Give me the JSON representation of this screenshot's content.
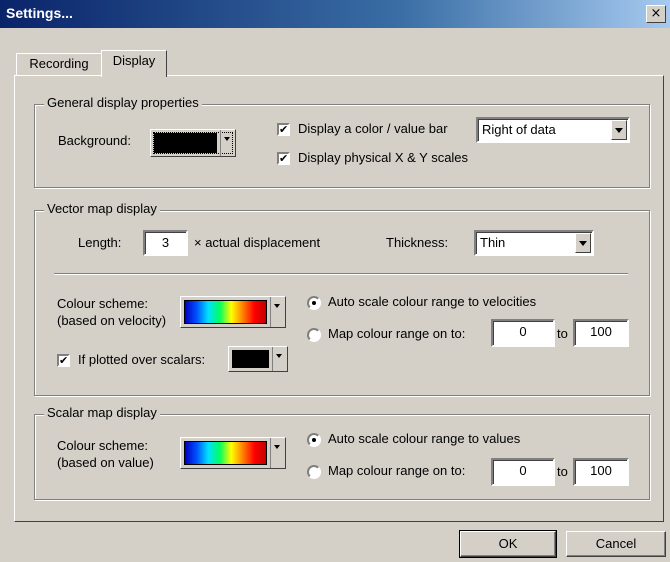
{
  "window": {
    "title": "Settings...",
    "close_label": "×"
  },
  "tabs": [
    {
      "label": "Recording"
    },
    {
      "label": "Display"
    }
  ],
  "general": {
    "group_title": "General display properties",
    "background_label": "Background:",
    "background_color": "#000000",
    "color_bar_label": "Display a color / value bar",
    "color_bar_checked": true,
    "color_bar_position": "Right of data",
    "physical_scales_label": "Display physical X & Y scales",
    "physical_scales_checked": true
  },
  "vector": {
    "group_title": "Vector map display",
    "length_label": "Length:",
    "length_value": "3",
    "length_suffix": "× actual displacement",
    "thickness_label": "Thickness:",
    "thickness_value": "Thin",
    "colour_scheme_label": "Colour scheme:",
    "colour_scheme_sub": "(based on velocity)",
    "auto_scale_label": "Auto scale colour range to velocities",
    "map_range_label": "Map colour range on to:",
    "range_min": "0",
    "range_to": "to",
    "range_max": "100",
    "overlay_label": "If plotted over scalars:",
    "overlay_checked": true,
    "overlay_color": "#000000"
  },
  "scalar": {
    "group_title": "Scalar map display",
    "colour_scheme_label": "Colour scheme:",
    "colour_scheme_sub": "(based on value)",
    "auto_scale_label": "Auto scale colour range to values",
    "map_range_label": "Map colour range on to:",
    "range_min": "0",
    "range_to": "to",
    "range_max": "100"
  },
  "buttons": {
    "ok": "OK",
    "cancel": "Cancel"
  },
  "icons": {
    "check": "✔"
  }
}
